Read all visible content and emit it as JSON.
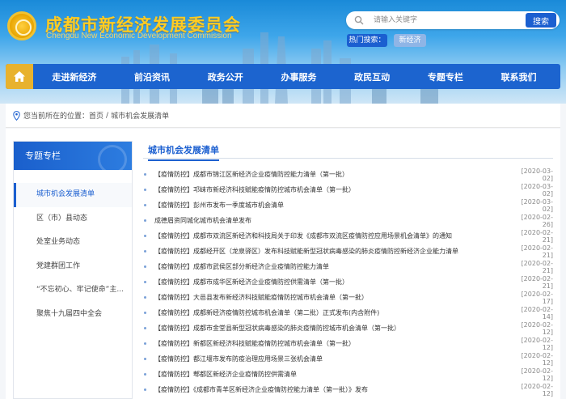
{
  "header": {
    "title": "成都市新经济发展委员会",
    "subtitle": "Chengdu New Economic Development Commission",
    "search": {
      "placeholder": "请输入关键字",
      "button": "搜索"
    },
    "hot": {
      "label": "热门搜索：",
      "tags": [
        "新经济"
      ]
    }
  },
  "nav": {
    "home_icon": "home-icon",
    "items": [
      "走进新经济",
      "前沿资讯",
      "政务公开",
      "办事服务",
      "政民互动",
      "专题专栏",
      "联系我们"
    ]
  },
  "breadcrumb": {
    "prefix": "您当前所在的位置：",
    "home": "首页",
    "separator": "/",
    "current": "城市机会发展清单"
  },
  "sidebar": {
    "title": "专题专栏",
    "items": [
      "城市机会发展清单",
      "区（市）县动态",
      "处室业务动态",
      "党建群团工作",
      "“不忘初心、牢记使命”主...",
      "聚焦十九届四中全会"
    ]
  },
  "main": {
    "title": "城市机会发展清单",
    "news": [
      {
        "title": "【疫情防控】成都市锦江区新经济企业疫情防控能力清单（第一批）",
        "date": "[2020-03-02]"
      },
      {
        "title": "【疫情防控】邛崃市新经济科技赋能疫情防控城市机会清单（第一批）",
        "date": "[2020-03-02]"
      },
      {
        "title": "【疫情防控】彭州市发布一季度城市机会清单",
        "date": "[2020-03-02]"
      },
      {
        "title": "成德眉资同城化城市机会清单发布",
        "date": "[2020-02-26]"
      },
      {
        "title": "【疫情防控】成都市双流区新经济和科技局关于印发《成都市双流区疫情防控应用场景机会清单》的通知",
        "date": "[2020-02-21]"
      },
      {
        "title": "【疫情防控】成都经开区（龙泉驿区）发布科技赋能新型冠状病毒感染的肺炎疫情防控新经济企业能力清单",
        "date": "[2020-02-21]"
      },
      {
        "title": "【疫情防控】成都市武侯区部分新经济企业疫情防控能力清单",
        "date": "[2020-02-21]"
      },
      {
        "title": "【疫情防控】成都市成华区新经济企业疫情防控供需清单（第一批）",
        "date": "[2020-02-21]"
      },
      {
        "title": "【疫情防控】大邑县发布新经济科技赋能疫情防控城市机会清单（第一批）",
        "date": "[2020-02-17]"
      },
      {
        "title": "【疫情防控】成都新经济疫情防控城市机会清单（第二批）正式发布(内含附件)",
        "date": "[2020-02-14]"
      },
      {
        "title": "【疫情防控】成都市金堂县新型冠状病毒感染的肺炎疫情防控城市机会清单（第一批）",
        "date": "[2020-02-12]"
      },
      {
        "title": "【疫情防控】新都区新经济科技赋能疫情防控城市机会清单（第一批）",
        "date": "[2020-02-12]"
      },
      {
        "title": "【疫情防控】都江堰市发布防疫治理应用场景三张机会清单",
        "date": "[2020-02-12]"
      },
      {
        "title": "【疫情防控】郫都区新经济企业疫情防控供需清单",
        "date": "[2020-02-12]"
      },
      {
        "title": "【疫情防控】《成都市青羊区新经济企业疫情防控能力清单（第一批）》发布",
        "date": "[2020-02-12]"
      }
    ]
  },
  "colors": {
    "brand_blue": "#1c64cf",
    "title_gold": "#ffcc22",
    "home_gold": "#e8b22e"
  }
}
